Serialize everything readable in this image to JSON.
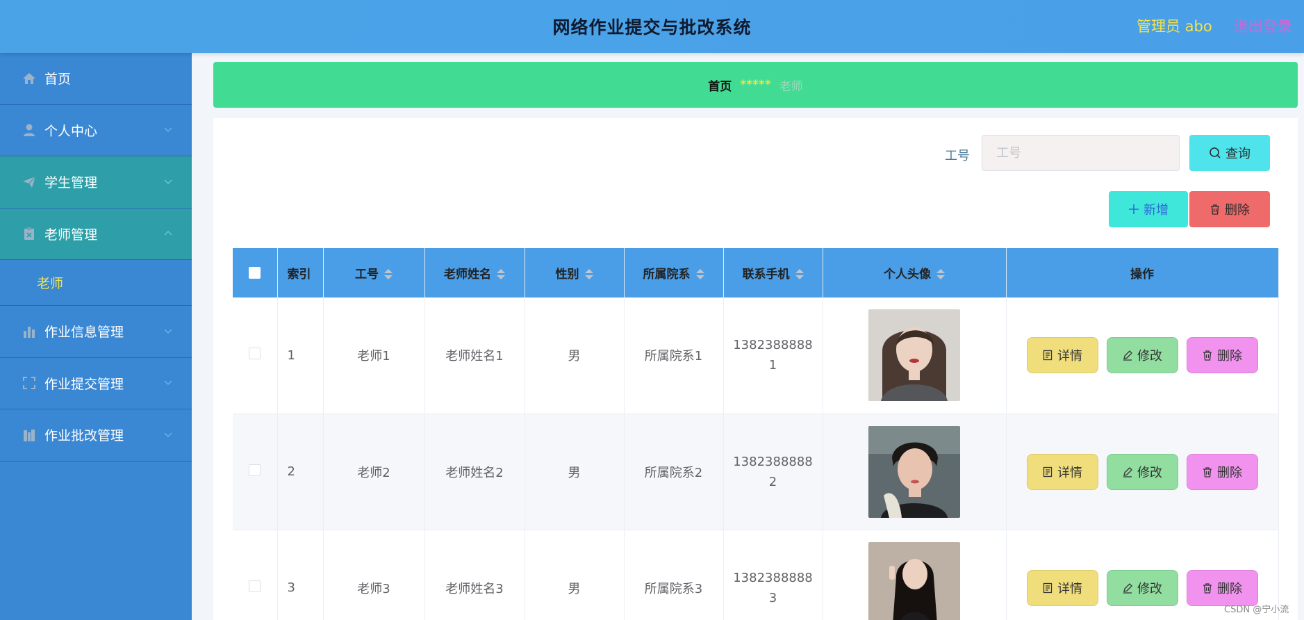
{
  "header": {
    "title": "网络作业提交与批改系统",
    "admin_label": "管理员 abo",
    "logout_label": "退出登录"
  },
  "sidebar": {
    "items": [
      {
        "label": "首页",
        "icon": "home-icon"
      },
      {
        "label": "个人中心",
        "icon": "user-icon"
      },
      {
        "label": "学生管理",
        "icon": "send-icon"
      },
      {
        "label": "老师管理",
        "icon": "clipboard-icon"
      },
      {
        "label": "老师",
        "icon": ""
      },
      {
        "label": "作业信息管理",
        "icon": "bar-chart-icon"
      },
      {
        "label": "作业提交管理",
        "icon": "fullscreen-icon"
      },
      {
        "label": "作业批改管理",
        "icon": "building-icon"
      }
    ]
  },
  "breadcrumb": {
    "home": "首页",
    "separator": "*****",
    "current": "老师"
  },
  "search": {
    "label": "工号",
    "placeholder": "工号",
    "value": "",
    "button_label": "查询"
  },
  "actions": {
    "add_label": "新增",
    "delete_label": "删除"
  },
  "table": {
    "columns": [
      "索引",
      "工号",
      "老师姓名",
      "性别",
      "所属院系",
      "联系手机",
      "个人头像",
      "操作"
    ],
    "rows": [
      {
        "index": "1",
        "id": "老师1",
        "name": "老师姓名1",
        "gender": "男",
        "dept": "所属院系1",
        "phone_a": "1382388888",
        "phone_b": "1",
        "avatar": "avatar-photo-1"
      },
      {
        "index": "2",
        "id": "老师2",
        "name": "老师姓名2",
        "gender": "男",
        "dept": "所属院系2",
        "phone_a": "1382388888",
        "phone_b": "2",
        "avatar": "avatar-photo-2"
      },
      {
        "index": "3",
        "id": "老师3",
        "name": "老师姓名3",
        "gender": "男",
        "dept": "所属院系3",
        "phone_a": "1382388888",
        "phone_b": "3",
        "avatar": "avatar-photo-3"
      }
    ],
    "row_actions": {
      "detail": "详情",
      "edit": "修改",
      "remove": "删除"
    }
  },
  "watermark": "CSDN @宁小流",
  "colors": {
    "header_bg": "#4aa3e7",
    "sidebar_bg": "#3a87d4",
    "sidebar_active": "#2e9fa8",
    "breadcrumb_bg": "#41db94",
    "accent_yellow": "#f3e34a"
  }
}
